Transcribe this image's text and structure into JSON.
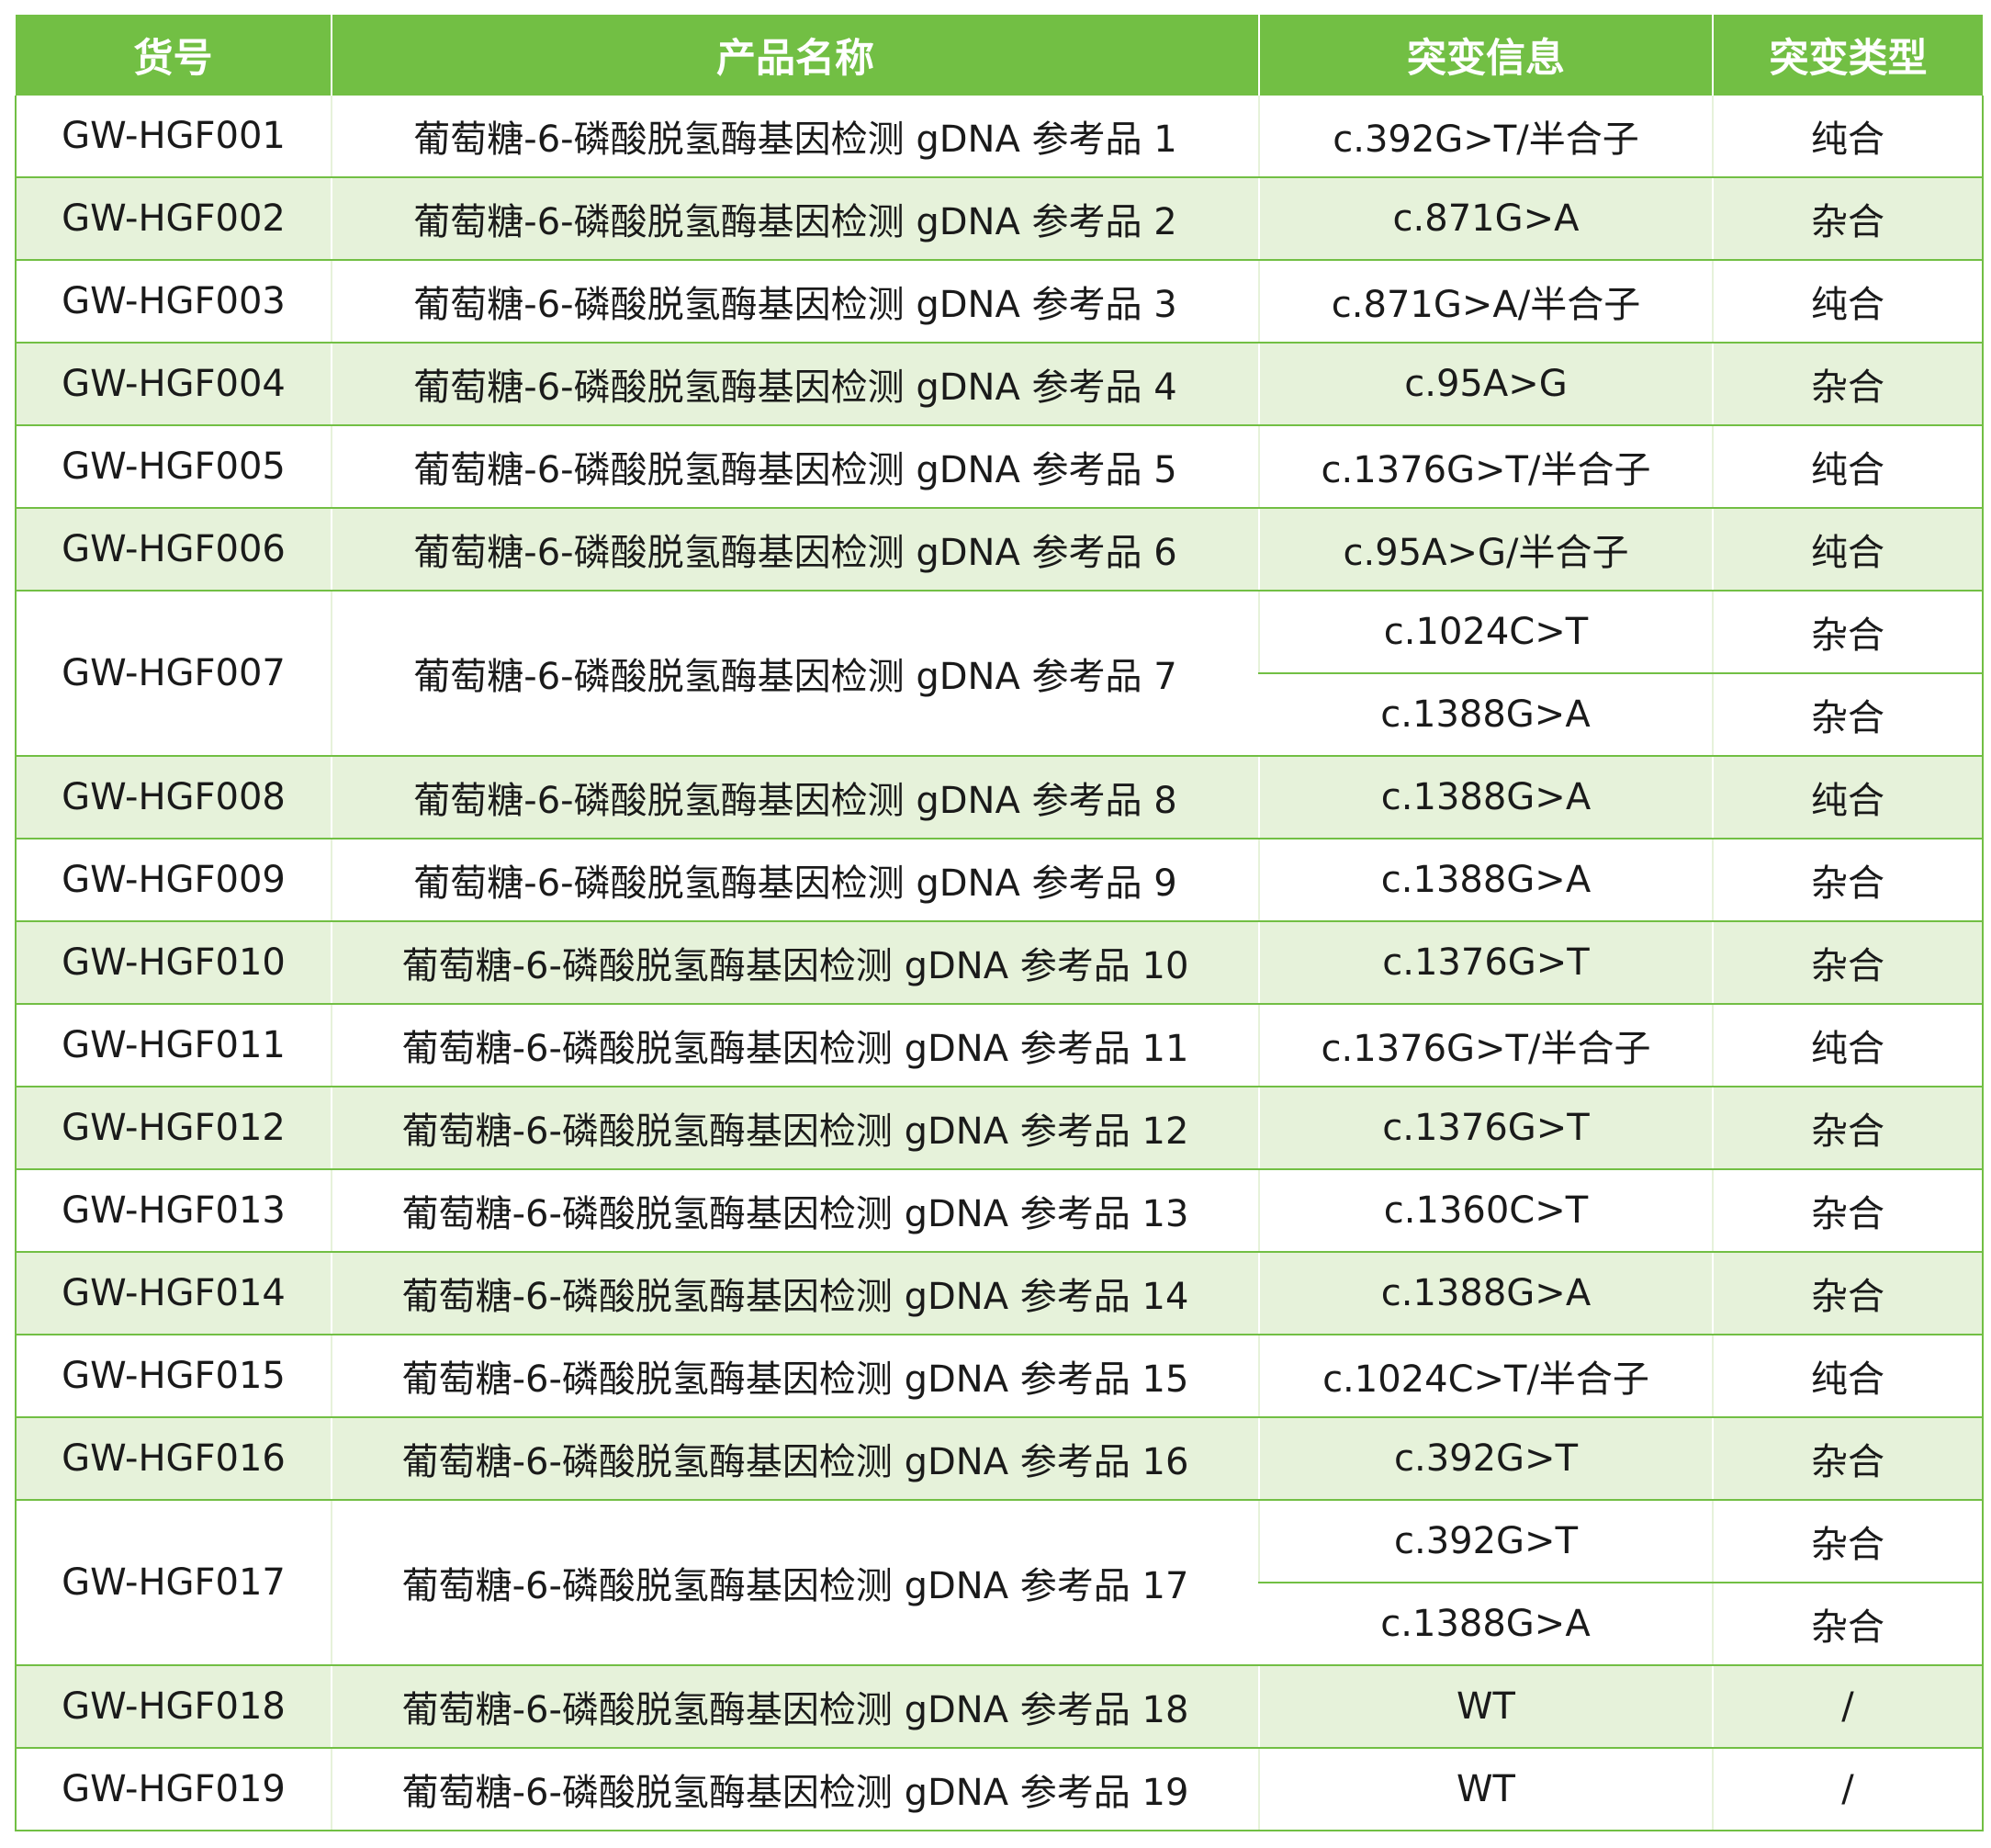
{
  "headers": [
    "货号",
    "产品名称",
    "突变信息",
    "突变类型"
  ],
  "rows": [
    {
      "id": "GW-HGF001",
      "name": "葡萄糖-6-磷酸脱氢酶基因检测 gDNA 参考品 1",
      "mutations": [
        {
          "info": "c.392G>T/半合子",
          "type": "纯合"
        }
      ]
    },
    {
      "id": "GW-HGF002",
      "name": "葡萄糖-6-磷酸脱氢酶基因检测 gDNA 参考品 2",
      "mutations": [
        {
          "info": "c.871G>A",
          "type": "杂合"
        }
      ]
    },
    {
      "id": "GW-HGF003",
      "name": "葡萄糖-6-磷酸脱氢酶基因检测 gDNA 参考品 3",
      "mutations": [
        {
          "info": "c.871G>A/半合子",
          "type": "纯合"
        }
      ]
    },
    {
      "id": "GW-HGF004",
      "name": "葡萄糖-6-磷酸脱氢酶基因检测 gDNA 参考品 4",
      "mutations": [
        {
          "info": "c.95A>G",
          "type": "杂合"
        }
      ]
    },
    {
      "id": "GW-HGF005",
      "name": "葡萄糖-6-磷酸脱氢酶基因检测 gDNA 参考品 5",
      "mutations": [
        {
          "info": "c.1376G>T/半合子",
          "type": "纯合"
        }
      ]
    },
    {
      "id": "GW-HGF006",
      "name": "葡萄糖-6-磷酸脱氢酶基因检测 gDNA 参考品 6",
      "mutations": [
        {
          "info": "c.95A>G/半合子",
          "type": "纯合"
        }
      ]
    },
    {
      "id": "GW-HGF007",
      "name": "葡萄糖-6-磷酸脱氢酶基因检测 gDNA 参考品 7",
      "mutations": [
        {
          "info": "c.1024C>T",
          "type": "杂合"
        },
        {
          "info": "c.1388G>A",
          "type": "杂合"
        }
      ]
    },
    {
      "id": "GW-HGF008",
      "name": "葡萄糖-6-磷酸脱氢酶基因检测 gDNA 参考品 8",
      "mutations": [
        {
          "info": "c.1388G>A",
          "type": "纯合"
        }
      ]
    },
    {
      "id": "GW-HGF009",
      "name": "葡萄糖-6-磷酸脱氢酶基因检测 gDNA 参考品 9",
      "mutations": [
        {
          "info": "c.1388G>A",
          "type": "杂合"
        }
      ]
    },
    {
      "id": "GW-HGF010",
      "name": "葡萄糖-6-磷酸脱氢酶基因检测 gDNA 参考品 10",
      "mutations": [
        {
          "info": "c.1376G>T",
          "type": "杂合"
        }
      ]
    },
    {
      "id": "GW-HGF011",
      "name": "葡萄糖-6-磷酸脱氢酶基因检测 gDNA 参考品 11",
      "mutations": [
        {
          "info": "c.1376G>T/半合子",
          "type": "纯合"
        }
      ]
    },
    {
      "id": "GW-HGF012",
      "name": "葡萄糖-6-磷酸脱氢酶基因检测 gDNA 参考品 12",
      "mutations": [
        {
          "info": "c.1376G>T",
          "type": "杂合"
        }
      ]
    },
    {
      "id": "GW-HGF013",
      "name": "葡萄糖-6-磷酸脱氢酶基因检测 gDNA 参考品 13",
      "mutations": [
        {
          "info": "c.1360C>T",
          "type": "杂合"
        }
      ]
    },
    {
      "id": "GW-HGF014",
      "name": "葡萄糖-6-磷酸脱氢酶基因检测 gDNA 参考品 14",
      "mutations": [
        {
          "info": "c.1388G>A",
          "type": "杂合"
        }
      ]
    },
    {
      "id": "GW-HGF015",
      "name": "葡萄糖-6-磷酸脱氢酶基因检测 gDNA 参考品 15",
      "mutations": [
        {
          "info": "c.1024C>T/半合子",
          "type": "纯合"
        }
      ]
    },
    {
      "id": "GW-HGF016",
      "name": "葡萄糖-6-磷酸脱氢酶基因检测 gDNA 参考品 16",
      "mutations": [
        {
          "info": "c.392G>T",
          "type": "杂合"
        }
      ]
    },
    {
      "id": "GW-HGF017",
      "name": "葡萄糖-6-磷酸脱氢酶基因检测 gDNA 参考品 17",
      "mutations": [
        {
          "info": "c.392G>T",
          "type": "杂合"
        },
        {
          "info": "c.1388G>A",
          "type": "杂合"
        }
      ]
    },
    {
      "id": "GW-HGF018",
      "name": "葡萄糖-6-磷酸脱氢酶基因检测 gDNA 参考品 18",
      "mutations": [
        {
          "info": "WT",
          "type": "/"
        }
      ]
    },
    {
      "id": "GW-HGF019",
      "name": "葡萄糖-6-磷酸脱氢酶基因检测 gDNA 参考品 19",
      "mutations": [
        {
          "info": "WT",
          "type": "/"
        }
      ]
    }
  ],
  "colors": {
    "header_bg": "#72bf44",
    "stripe_bg": "#e6f2da",
    "grid_line": "#72bf44"
  }
}
